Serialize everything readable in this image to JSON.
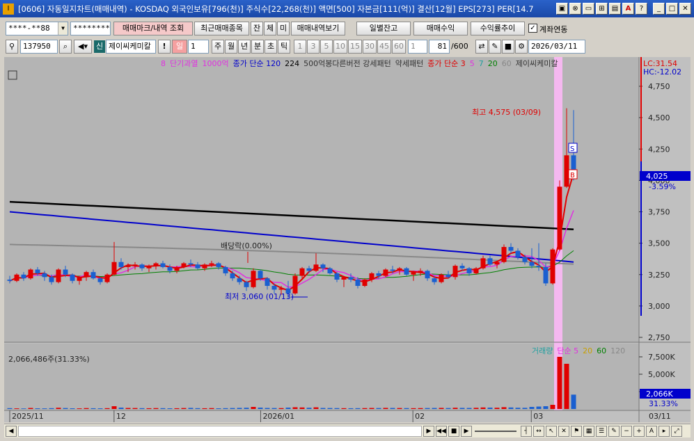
{
  "window": {
    "title": "[0606] 자동일지차트(매매내역) - KOSDAQ 외국인보유[796(천)] 주식수[22,268(천)] 액면[500] 자본금[111(억)] 결산[12월] EPS[273] PER[14.7",
    "icon": "I"
  },
  "toolbar1": {
    "account": "****-**88",
    "password": "********",
    "btn_trade_mark": "매매마크/내역 조회",
    "btn_recent": "최근매매종목",
    "tab_jan": "잔",
    "tab_che": "체",
    "tab_mi": "미",
    "btn_trade_view": "매매내역보기",
    "btn_daily": "일별잔고",
    "btn_profit": "매매수익",
    "btn_return": "수익률추이",
    "chk_account_link_label": "계좌연동",
    "chk_account_link": true
  },
  "toolbar2": {
    "stock_code": "137950",
    "badge": "신",
    "stock_name": "제이씨케미칼",
    "period_day": "일",
    "period_num": "1",
    "periods": [
      "주",
      "월",
      "년",
      "분",
      "초",
      "틱"
    ],
    "intervals": [
      "1",
      "3",
      "5",
      "10",
      "15",
      "30",
      "45",
      "60"
    ],
    "minute_val": "1",
    "count": "81",
    "count_total": "/600",
    "date": "2026/03/11"
  },
  "legend": {
    "items": [
      {
        "text": "8",
        "color": "#e030e0"
      },
      {
        "text": "단기과열",
        "color": "#e030e0"
      },
      {
        "text": "1000억",
        "color": "#e030e0"
      },
      {
        "text": "종가 단순 120",
        "color": "#0000cc"
      },
      {
        "text": "224",
        "color": "#000000"
      },
      {
        "text": "500억봉다른버전 강세패턴",
        "color": "#333333"
      },
      {
        "text": "약세패턴",
        "color": "#333333"
      },
      {
        "text": "종가 단순 3",
        "color": "#e00000"
      },
      {
        "text": "5",
        "color": "#e030e0"
      },
      {
        "text": "7",
        "color": "#20a0a0"
      },
      {
        "text": "20",
        "color": "#008000"
      },
      {
        "text": "60",
        "color": "#888888"
      },
      {
        "text": "제이씨케미칼",
        "color": "#333333"
      }
    ],
    "lc": "LC:31.54",
    "hc": "HC:-12.02"
  },
  "annotations": {
    "high": "최고 4,575 (03/09)",
    "low": "최저 3,060 (01/13)",
    "dividend": "배당락(0.00%)",
    "sell_mark": "S",
    "buy_mark": "B",
    "current_price": "4,025",
    "current_change": "-3.59%"
  },
  "volume": {
    "label": "2,066,486주(31.33%)",
    "legend": [
      {
        "text": "거래량",
        "color": "#20a0a0"
      },
      {
        "text": "단순 5",
        "color": "#e030e0"
      },
      {
        "text": "20",
        "color": "#c8a000"
      },
      {
        "text": "60",
        "color": "#008000"
      },
      {
        "text": "120",
        "color": "#888888"
      }
    ],
    "current": "2,066K",
    "current_pct": "31.33%"
  },
  "xaxis": {
    "labels": [
      "2025/11",
      "12",
      "2026/01",
      "02",
      "03"
    ],
    "right_label": "03/11"
  },
  "chart_data": {
    "type": "candlestick",
    "price_axis": {
      "min": 2750,
      "max": 4750,
      "ticks": [
        "4,750",
        "4,500",
        "4,250",
        "4,000",
        "3,750",
        "3,500",
        "3,250",
        "3,000",
        "2,750"
      ]
    },
    "volume_axis": {
      "ticks": [
        "7,500K",
        "5,000K",
        "2,500K"
      ]
    },
    "candles": [
      [
        3210,
        3240,
        3180,
        3200
      ],
      [
        3200,
        3260,
        3190,
        3250
      ],
      [
        3250,
        3270,
        3200,
        3220
      ],
      [
        3220,
        3300,
        3210,
        3290
      ],
      [
        3290,
        3310,
        3240,
        3260
      ],
      [
        3260,
        3280,
        3200,
        3230
      ],
      [
        3230,
        3250,
        3170,
        3190
      ],
      [
        3190,
        3300,
        3180,
        3290
      ],
      [
        3290,
        3320,
        3230,
        3250
      ],
      [
        3250,
        3260,
        3180,
        3200
      ],
      [
        3200,
        3240,
        3170,
        3230
      ],
      [
        3230,
        3280,
        3200,
        3270
      ],
      [
        3270,
        3290,
        3210,
        3220
      ],
      [
        3220,
        3230,
        3170,
        3190
      ],
      [
        3190,
        3260,
        3180,
        3250
      ],
      [
        3250,
        3510,
        3240,
        3350
      ],
      [
        3350,
        3380,
        3290,
        3310
      ],
      [
        3310,
        3340,
        3270,
        3320
      ],
      [
        3320,
        3350,
        3290,
        3330
      ],
      [
        3330,
        3340,
        3280,
        3300
      ],
      [
        3300,
        3330,
        3270,
        3320
      ],
      [
        3320,
        3350,
        3290,
        3340
      ],
      [
        3340,
        3360,
        3300,
        3310
      ],
      [
        3310,
        3330,
        3260,
        3280
      ],
      [
        3280,
        3320,
        3260,
        3310
      ],
      [
        3310,
        3350,
        3300,
        3340
      ],
      [
        3340,
        3370,
        3310,
        3330
      ],
      [
        3330,
        3350,
        3290,
        3300
      ],
      [
        3300,
        3340,
        3280,
        3330
      ],
      [
        3330,
        3360,
        3310,
        3340
      ],
      [
        3340,
        3350,
        3290,
        3310
      ],
      [
        3310,
        3320,
        3240,
        3260
      ],
      [
        3260,
        3280,
        3200,
        3220
      ],
      [
        3220,
        3240,
        3170,
        3190
      ],
      [
        3190,
        3200,
        3120,
        3150
      ],
      [
        3150,
        3300,
        3140,
        3280
      ],
      [
        3280,
        3290,
        3200,
        3220
      ],
      [
        3220,
        3230,
        3130,
        3160
      ],
      [
        3160,
        3180,
        3100,
        3130
      ],
      [
        3130,
        3160,
        3090,
        3140
      ],
      [
        3140,
        3200,
        3060,
        3100
      ],
      [
        3100,
        3260,
        3090,
        3240
      ],
      [
        3240,
        3310,
        3220,
        3300
      ],
      [
        3300,
        3320,
        3260,
        3280
      ],
      [
        3280,
        3420,
        3270,
        3330
      ],
      [
        3330,
        3340,
        3270,
        3300
      ],
      [
        3300,
        3310,
        3250,
        3260
      ],
      [
        3260,
        3270,
        3190,
        3210
      ],
      [
        3210,
        3240,
        3150,
        3230
      ],
      [
        3230,
        3260,
        3190,
        3210
      ],
      [
        3210,
        3230,
        3140,
        3160
      ],
      [
        3160,
        3220,
        3150,
        3210
      ],
      [
        3210,
        3270,
        3190,
        3260
      ],
      [
        3260,
        3280,
        3220,
        3240
      ],
      [
        3240,
        3300,
        3230,
        3290
      ],
      [
        3290,
        3320,
        3260,
        3280
      ],
      [
        3280,
        3310,
        3250,
        3300
      ],
      [
        3300,
        3310,
        3240,
        3250
      ],
      [
        3250,
        3280,
        3200,
        3270
      ],
      [
        3270,
        3300,
        3240,
        3280
      ],
      [
        3280,
        3290,
        3200,
        3220
      ],
      [
        3220,
        3240,
        3170,
        3190
      ],
      [
        3190,
        3260,
        3180,
        3250
      ],
      [
        3250,
        3280,
        3220,
        3230
      ],
      [
        3230,
        3330,
        3210,
        3320
      ],
      [
        3320,
        3340,
        3280,
        3300
      ],
      [
        3300,
        3310,
        3240,
        3260
      ],
      [
        3260,
        3310,
        3250,
        3300
      ],
      [
        3300,
        3400,
        3290,
        3380
      ],
      [
        3380,
        3400,
        3320,
        3330
      ],
      [
        3330,
        3360,
        3300,
        3350
      ],
      [
        3350,
        3490,
        3340,
        3470
      ],
      [
        3470,
        3500,
        3420,
        3440
      ],
      [
        3440,
        3460,
        3370,
        3390
      ],
      [
        3390,
        3410,
        3330,
        3350
      ],
      [
        3350,
        3460,
        3300,
        3320
      ],
      [
        3320,
        3500,
        3280,
        3310
      ],
      [
        3310,
        3340,
        3160,
        3180
      ],
      [
        3180,
        3460,
        3170,
        3450
      ],
      [
        3450,
        4000,
        3440,
        3950
      ],
      [
        3950,
        4575,
        3940,
        4200
      ],
      [
        4200,
        4560,
        4000,
        4025
      ]
    ],
    "volumes": [
      120,
      90,
      80,
      150,
      100,
      90,
      120,
      180,
      140,
      100,
      90,
      130,
      110,
      95,
      120,
      400,
      200,
      150,
      140,
      120,
      110,
      130,
      120,
      100,
      110,
      140,
      160,
      120,
      110,
      130,
      100,
      120,
      140,
      160,
      180,
      300,
      200,
      150,
      140,
      130,
      200,
      250,
      220,
      180,
      240,
      150,
      140,
      130,
      120,
      110,
      120,
      130,
      150,
      140,
      160,
      150,
      140,
      130,
      120,
      130,
      140,
      150,
      160,
      140,
      180,
      160,
      150,
      170,
      220,
      200,
      180,
      260,
      220,
      180,
      170,
      300,
      350,
      400,
      600,
      7500,
      6500,
      2066
    ]
  }
}
